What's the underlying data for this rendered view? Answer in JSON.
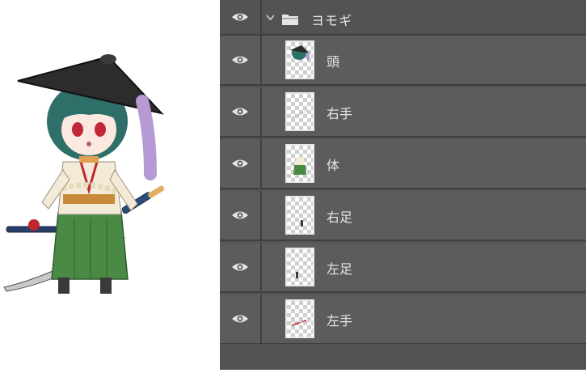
{
  "layers_panel": {
    "group": {
      "name": "ヨモギ",
      "icon": "folder-icon",
      "expanded": true,
      "visibility_icon": "eye-icon"
    },
    "layers": [
      {
        "name": "頭",
        "visibility_icon": "eye-icon"
      },
      {
        "name": "右手",
        "visibility_icon": "eye-icon"
      },
      {
        "name": "体",
        "visibility_icon": "eye-icon"
      },
      {
        "name": "右足",
        "visibility_icon": "eye-icon"
      },
      {
        "name": "左足",
        "visibility_icon": "eye-icon"
      },
      {
        "name": "左手",
        "visibility_icon": "eye-icon"
      }
    ]
  },
  "colors": {
    "panel_bg": "#535353",
    "row_bg": "#5c5c5c",
    "separator": "#3f3f3f",
    "text": "#e6e6e6"
  }
}
